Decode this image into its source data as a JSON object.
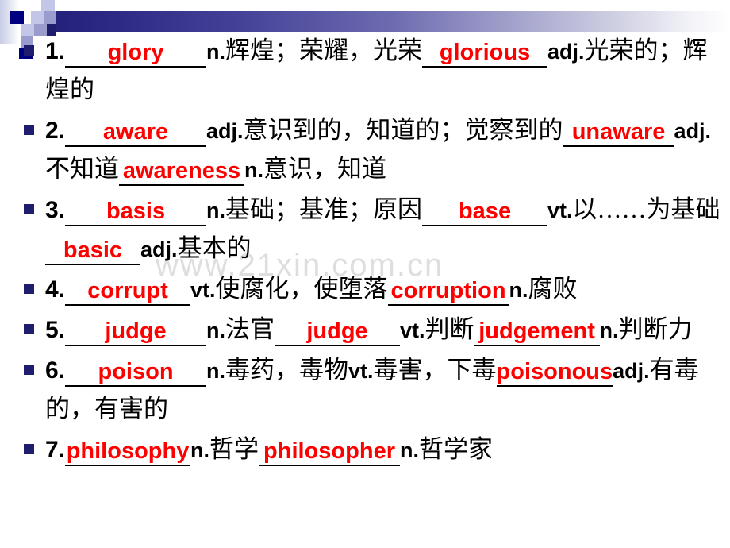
{
  "slide": {
    "watermark": "www.21xin.com.cn",
    "accent_red": "#ff0000",
    "accent_navy": "#1f1d6e",
    "title_bar_color": "#23217a",
    "background": "#ffffff"
  },
  "items": [
    {
      "number": "1.",
      "parts": [
        {
          "type": "blank",
          "text": "glory",
          "width": "w-lg"
        },
        {
          "type": "pos",
          "text": "n."
        },
        {
          "type": "cn",
          "text": "辉煌；荣耀，光荣"
        },
        {
          "type": "blank",
          "text": "glorious",
          "width": "w-md"
        },
        {
          "type": "pos",
          "text": "adj."
        },
        {
          "type": "cn",
          "text": "光荣的；辉煌的"
        }
      ]
    },
    {
      "number": "2.",
      "parts": [
        {
          "type": "blank",
          "text": "aware",
          "width": "w-lg"
        },
        {
          "type": "pos",
          "text": "adj."
        },
        {
          "type": "cn",
          "text": "意识到的，知道的；觉察到的"
        },
        {
          "type": "blank",
          "text": "unaware",
          "width": "w-sm"
        },
        {
          "type": "pos",
          "text": "adj."
        },
        {
          "type": "cn",
          "text": "不知道"
        },
        {
          "type": "blank",
          "text": "awareness",
          "width": "w-md"
        },
        {
          "type": "pos",
          "text": "n."
        },
        {
          "type": "cn",
          "text": "意识，知道"
        }
      ]
    },
    {
      "number": "3.",
      "parts": [
        {
          "type": "blank",
          "text": "basis",
          "width": "w-lg"
        },
        {
          "type": "pos",
          "text": "n."
        },
        {
          "type": "cn",
          "text": "基础；基准；原因"
        },
        {
          "type": "blank",
          "text": "base",
          "width": "w-md"
        },
        {
          "type": "pos",
          "text": "vt."
        },
        {
          "type": "cn",
          "text": "以……为基础"
        },
        {
          "type": "blank",
          "text": "basic",
          "width": "w-xs"
        },
        {
          "type": "pos",
          "text": "adj."
        },
        {
          "type": "cn",
          "text": "基本的"
        }
      ]
    },
    {
      "number": "4.",
      "parts": [
        {
          "type": "blank",
          "text": "corrupt",
          "width": "w-md"
        },
        {
          "type": "pos",
          "text": "vt."
        },
        {
          "type": "cn",
          "text": "使腐化，使堕落"
        },
        {
          "type": "blank",
          "text": "corruption",
          "width": "tight"
        },
        {
          "type": "pos",
          "text": "n."
        },
        {
          "type": "cn",
          "text": "腐败"
        }
      ]
    },
    {
      "number": "5.",
      "parts": [
        {
          "type": "blank",
          "text": "judge",
          "width": "w-lg"
        },
        {
          "type": "pos",
          "text": "n."
        },
        {
          "type": "cn",
          "text": "法官"
        },
        {
          "type": "blank",
          "text": "judge",
          "width": "w-md"
        },
        {
          "type": "pos",
          "text": "vt."
        },
        {
          "type": "cn",
          "text": "判断"
        },
        {
          "type": "blank",
          "text": "judgement",
          "width": "w-md"
        },
        {
          "type": "pos",
          "text": "n."
        },
        {
          "type": "cn",
          "text": "判断力"
        }
      ]
    },
    {
      "number": "6.",
      "parts": [
        {
          "type": "blank",
          "text": "poison",
          "width": "w-lg"
        },
        {
          "type": "pos",
          "text": "n."
        },
        {
          "type": "cn",
          "text": "毒药，毒物"
        },
        {
          "type": "pos",
          "text": "vt."
        },
        {
          "type": "cn",
          "text": "毒害，下毒"
        },
        {
          "type": "blank",
          "text": "poisonous",
          "width": "w-xs"
        },
        {
          "type": "pos",
          "text": "adj."
        },
        {
          "type": "cn",
          "text": "有毒的，有害的"
        }
      ]
    },
    {
      "number": "7.",
      "parts": [
        {
          "type": "blank",
          "text": "philosophy",
          "width": "w-md"
        },
        {
          "type": "pos",
          "text": "n."
        },
        {
          "type": "cn",
          "text": "哲学"
        },
        {
          "type": "blank",
          "text": "philosopher",
          "width": "w-lg"
        },
        {
          "type": "pos",
          "text": "n."
        },
        {
          "type": "cn",
          "text": "哲学家"
        }
      ]
    }
  ]
}
